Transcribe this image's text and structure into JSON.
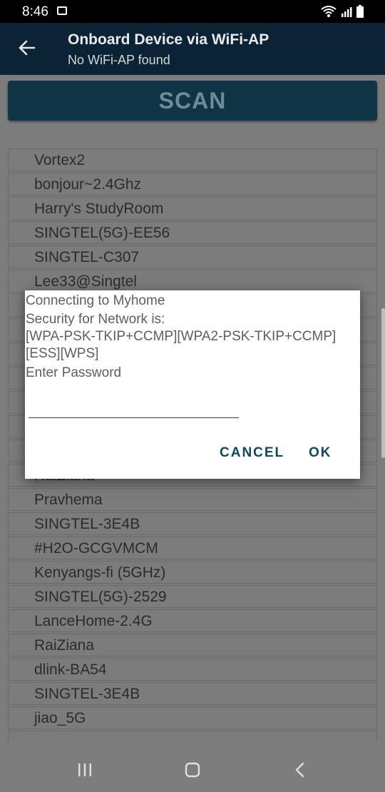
{
  "status": {
    "time": "8:46"
  },
  "header": {
    "title": "Onboard Device via WiFi-AP",
    "subtitle": "No WiFi-AP found"
  },
  "scan": {
    "label": "SCAN"
  },
  "networks": [
    "Vortex2",
    "bonjour~2.4Ghz",
    "Harry's StudyRoom",
    "SINGTEL(5G)-EE56",
    "SINGTEL-C307",
    "Lee33@Singtel",
    "",
    "",
    "",
    "",
    "",
    "",
    "",
    "RaiZiana",
    "Pravhema",
    "SINGTEL-3E4B",
    "#H2O-GCGVMCM",
    "Kenyangs-fi (5GHz)",
    "SINGTEL(5G)-2529",
    "LanceHome-2.4G",
    "RaiZiana",
    "dlink-BA54",
    "SINGTEL-3E4B",
    "jiao_5G",
    "                 "
  ],
  "dialog": {
    "line1": "Connecting to Myhome",
    "line2": "Security for Network is:",
    "line3": "[WPA-PSK-TKIP+CCMP][WPA2-PSK-TKIP+CCMP]",
    "line4": "[ESS][WPS]",
    "line5": "Enter Password",
    "password": "",
    "cancel": "CANCEL",
    "ok": "OK"
  },
  "icons": {
    "back": "arrow-left-icon",
    "wifi": "wifi-icon",
    "signal": "signal-icon",
    "battery": "battery-icon",
    "photo": "image-icon",
    "recents": "recents-icon",
    "home": "home-icon",
    "nav_back": "nav-back-icon"
  },
  "colors": {
    "appbar": "#0a2436",
    "scan_button": "#0f3446",
    "dialog_button": "#0c4a62"
  }
}
